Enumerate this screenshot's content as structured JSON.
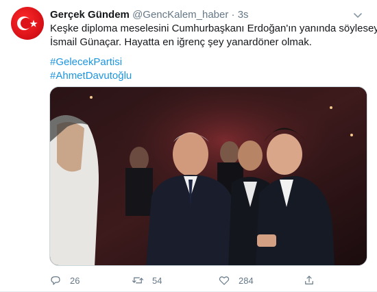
{
  "tweet": {
    "author_name": "Gerçek Gündem",
    "handle": "@GencKalem_haber",
    "separator": "·",
    "time": "3s",
    "text_lines": [
      "Keşke diploma meselesini Cumhurbaşkanı Erdoğan'ın yanında söyleseydin",
      "İsmail Günaçar. Hayatta en iğrenç şey yanardöner olmak."
    ],
    "hashtags": [
      "#GelecekPartisi",
      "#AhmetDavutoğlu"
    ]
  },
  "actions": {
    "reply_count": "26",
    "retweet_count": "54",
    "like_count": "284"
  },
  "icons": {
    "avatar": "turkish-flag-avatar",
    "more": "chevron-down-icon",
    "reply": "reply-icon",
    "retweet": "retweet-icon",
    "like": "heart-icon",
    "share": "share-icon"
  },
  "colors": {
    "link": "#1b95e0",
    "muted": "#657786",
    "flag_red": "#e30a17"
  }
}
